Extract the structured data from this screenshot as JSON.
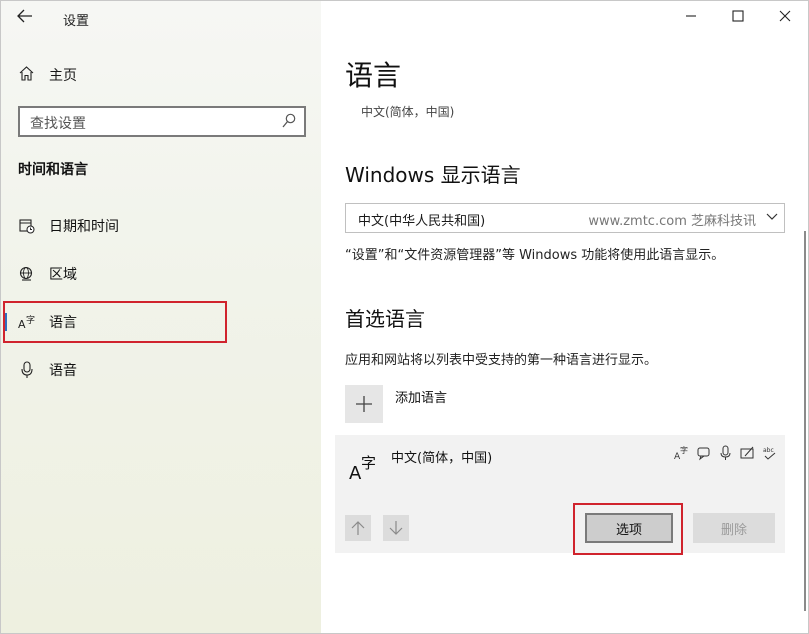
{
  "window": {
    "title": "设置"
  },
  "left": {
    "home_label": "主页",
    "search_placeholder": "查找设置",
    "section_title": "时间和语言",
    "nav": [
      {
        "label": "日期和时间",
        "icon": "calendar-clock-icon"
      },
      {
        "label": "区域",
        "icon": "globe-region-icon"
      },
      {
        "label": "语言",
        "icon": "language-icon",
        "active": true
      },
      {
        "label": "语音",
        "icon": "microphone-icon"
      }
    ]
  },
  "main": {
    "title": "语言",
    "subtitle": "中文(简体，中国)",
    "display_lang_heading": "Windows 显示语言",
    "display_lang_value": "中文(中华人民共和国)",
    "watermark": "www.zmtc.com 芝麻科技讯",
    "display_lang_desc": "“设置”和“文件资源管理器”等 Windows 功能将使用此语言显示。",
    "preferred_heading": "首选语言",
    "preferred_desc": "应用和网站将以列表中受支持的第一种语言进行显示。",
    "add_language_label": "添加语言",
    "languages": [
      {
        "name": "中文(简体，中国)"
      }
    ],
    "options_label": "选项",
    "remove_label": "删除"
  },
  "colors": {
    "highlight": "#d0232d",
    "accent": "#2f6ebd"
  }
}
